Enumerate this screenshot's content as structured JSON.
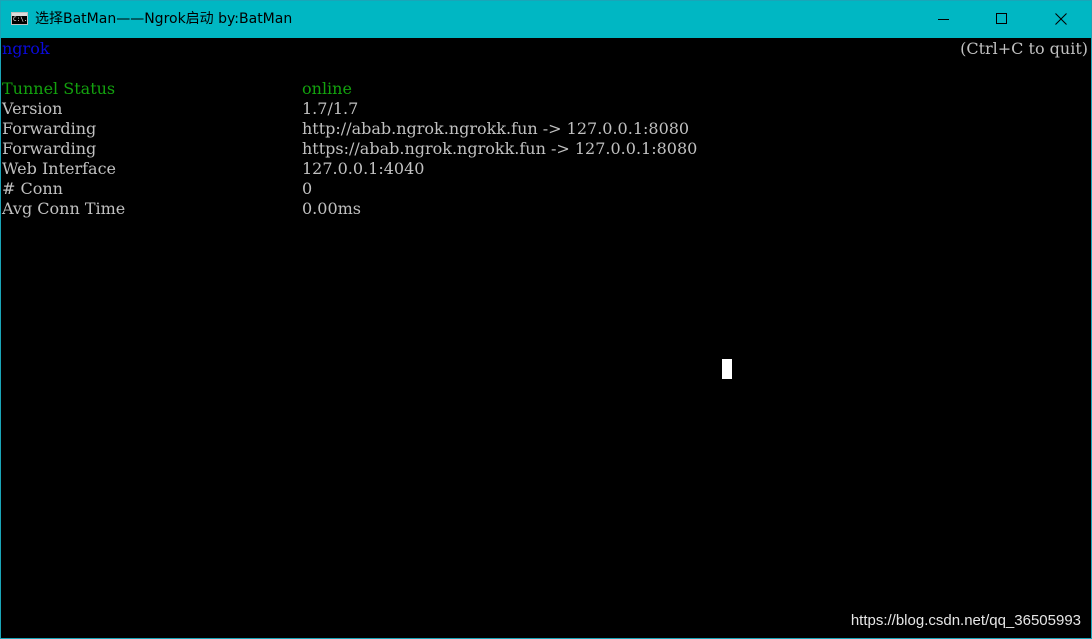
{
  "window": {
    "title": "选择BatMan——Ngrok启动 by:BatMan",
    "icon_text": "C:\\."
  },
  "console": {
    "header": "ngrok",
    "quit_hint": "(Ctrl+C to quit)",
    "rows": [
      {
        "label": "Tunnel Status",
        "value": "online"
      },
      {
        "label": "Version",
        "value": "1.7/1.7"
      },
      {
        "label": "Forwarding",
        "value": "http://abab.ngrok.ngrokk.fun -> 127.0.0.1:8080"
      },
      {
        "label": "Forwarding",
        "value": "https://abab.ngrok.ngrokk.fun -> 127.0.0.1:8080"
      },
      {
        "label": "Web Interface",
        "value": "127.0.0.1:4040"
      },
      {
        "label": "# Conn",
        "value": "0"
      },
      {
        "label": "Avg Conn Time",
        "value": "0.00ms"
      }
    ]
  },
  "watermark": "https://blog.csdn.net/qq_36505993",
  "colors": {
    "titlebar": "#00b7c3",
    "header_blue": "#0a0adc",
    "status_green": "#13a10e",
    "text_gray": "#c0c0c0",
    "background": "#000000"
  }
}
